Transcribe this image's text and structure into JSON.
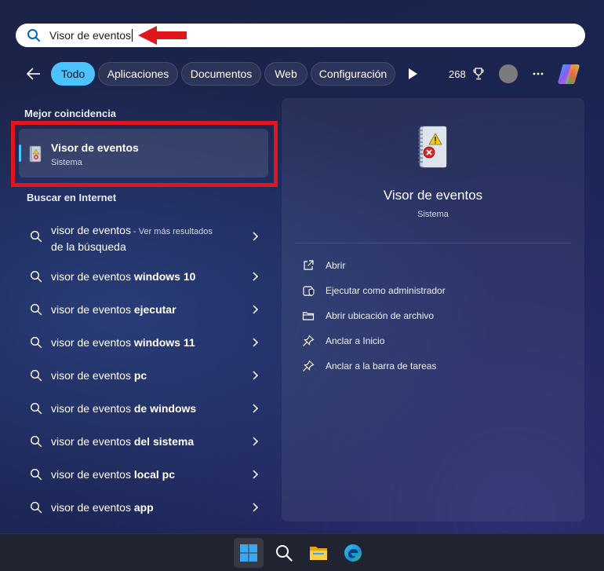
{
  "search": {
    "value": "Visor de eventos"
  },
  "filters": {
    "items": [
      {
        "label": "Todo"
      },
      {
        "label": "Aplicaciones"
      },
      {
        "label": "Documentos"
      },
      {
        "label": "Web"
      },
      {
        "label": "Configuración"
      }
    ]
  },
  "header": {
    "points": "268"
  },
  "best_match": {
    "section_title": "Mejor coincidencia",
    "title": "Visor de eventos",
    "subtitle": "Sistema"
  },
  "web_search": {
    "section_title": "Buscar en Internet",
    "first": {
      "query": "visor de eventos",
      "note_line1": " - Ver más resultados",
      "note_line2": "de la búsqueda"
    },
    "suggestions": [
      {
        "prefix": "visor de eventos ",
        "bold": "windows 10"
      },
      {
        "prefix": "visor de eventos ",
        "bold": "ejecutar"
      },
      {
        "prefix": "visor de eventos ",
        "bold": "windows 11"
      },
      {
        "prefix": "visor de eventos ",
        "bold": "pc"
      },
      {
        "prefix": "visor de eventos ",
        "bold": "de windows"
      },
      {
        "prefix": "visor de eventos ",
        "bold": "del sistema"
      },
      {
        "prefix": "visor de eventos ",
        "bold": "local pc"
      },
      {
        "prefix": "visor de eventos ",
        "bold": "app"
      }
    ]
  },
  "detail": {
    "title": "Visor de eventos",
    "subtitle": "Sistema",
    "actions": [
      {
        "label": "Abrir",
        "icon": "open-external-icon"
      },
      {
        "label": "Ejecutar como administrador",
        "icon": "shield-admin-icon"
      },
      {
        "label": "Abrir ubicación de archivo",
        "icon": "folder-icon"
      },
      {
        "label": "Anclar a Inicio",
        "icon": "pin-icon"
      },
      {
        "label": "Anclar a la barra de tareas",
        "icon": "pin-icon"
      }
    ]
  },
  "taskbar": {
    "items": [
      {
        "icon": "windows-start-icon"
      },
      {
        "icon": "search-icon"
      },
      {
        "icon": "file-explorer-icon"
      },
      {
        "icon": "edge-browser-icon"
      }
    ]
  },
  "colors": {
    "accent": "#4cc2ff",
    "highlight_red": "#e0161c"
  }
}
